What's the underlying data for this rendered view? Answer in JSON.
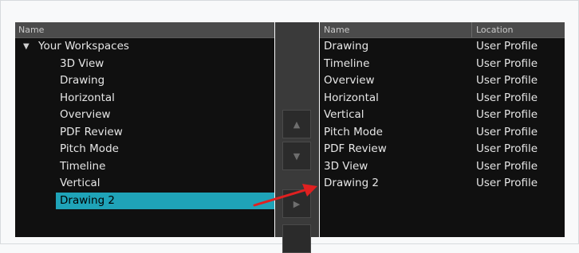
{
  "left": {
    "header": "Name",
    "root_label": "Your Workspaces",
    "caret": "▼",
    "items": [
      "3D View",
      "Drawing",
      "Horizontal",
      "Overview",
      "PDF Review",
      "Pitch Mode",
      "Timeline",
      "Vertical",
      "Drawing 2"
    ]
  },
  "mid": {
    "up_icon": "▲",
    "down_icon": "▼",
    "add_icon": "▶"
  },
  "right": {
    "header_name": "Name",
    "header_location": "Location",
    "rows": [
      {
        "name": "Drawing",
        "location": "User Profile"
      },
      {
        "name": "Timeline",
        "location": "User Profile"
      },
      {
        "name": "Overview",
        "location": "User Profile"
      },
      {
        "name": "Horizontal",
        "location": "User Profile"
      },
      {
        "name": "Vertical",
        "location": "User Profile"
      },
      {
        "name": "Pitch Mode",
        "location": "User Profile"
      },
      {
        "name": "PDF Review",
        "location": "User Profile"
      },
      {
        "name": "3D View",
        "location": "User Profile"
      },
      {
        "name": "Drawing 2",
        "location": "User Profile"
      }
    ]
  },
  "colors": {
    "selection": "#1fa3b8",
    "annotation_arrow": "#e02020"
  }
}
